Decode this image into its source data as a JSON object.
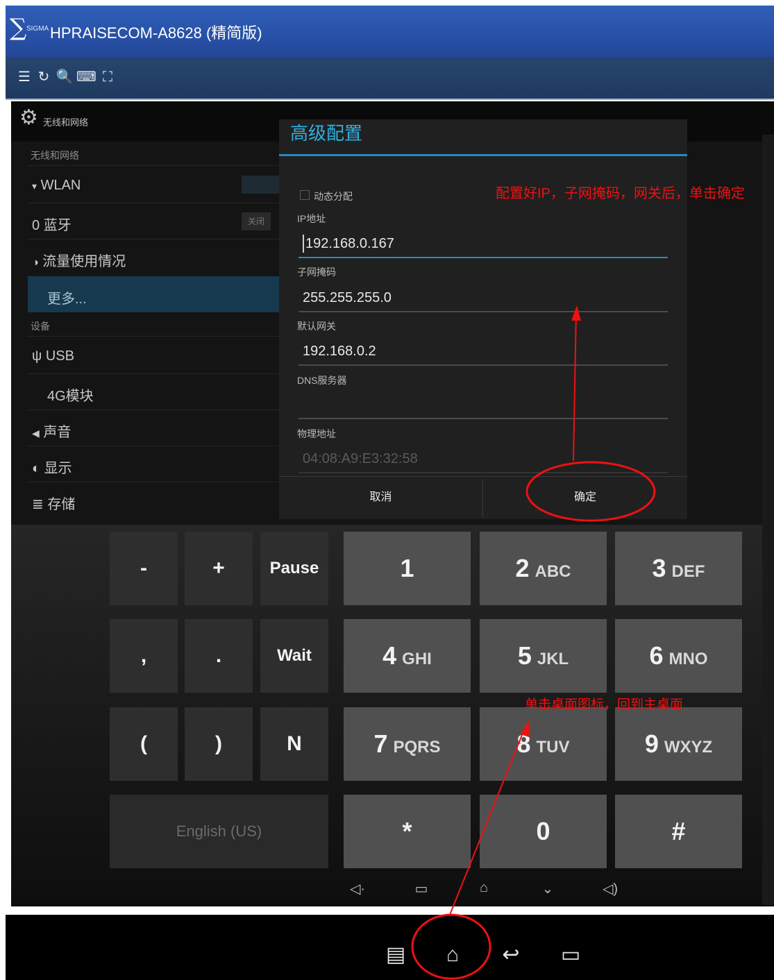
{
  "window": {
    "logo_glyph": "∑",
    "logo_small": "SIGMA",
    "title": "HPRAISECOM-A8628 (精简版)"
  },
  "toolbar": {
    "icons": [
      "menu-icon",
      "rotate-icon",
      "zoom-icon",
      "keyboard-icon",
      "fullscreen-icon"
    ],
    "glyphs": [
      "☰",
      "↻",
      "🔍",
      "⌨",
      "⛶"
    ]
  },
  "settings": {
    "header_title": "无线和网络",
    "category_wireless": "无线和网络",
    "items": [
      {
        "icon": "▾",
        "label": "WLAN"
      },
      {
        "icon": "0",
        "label": "蓝牙"
      },
      {
        "icon": "◑",
        "label": "流量使用情况"
      },
      {
        "icon": "",
        "label": "更多..."
      }
    ],
    "bluetooth_toggle": "关闭",
    "category_device": "设备",
    "device_items": [
      {
        "icon": "ψ",
        "label": "USB"
      },
      {
        "icon": "",
        "label": "4G模块"
      },
      {
        "icon": "◀",
        "label": "声音"
      },
      {
        "icon": "◐",
        "label": "显示"
      },
      {
        "icon": "≣",
        "label": "存储"
      }
    ]
  },
  "dialog": {
    "title": "高级配置",
    "dhcp_label": "动态分配",
    "ip_label": "IP地址",
    "ip_value": "192.168.0.167",
    "mask_label": "子网掩码",
    "mask_value": "255.255.255.0",
    "gateway_label": "默认网关",
    "gateway_value": "192.168.0.2",
    "dns_label": "DNS服务器",
    "dns_value": "",
    "mac_label": "物理地址",
    "mac_value": "04:08:A9:E3:32:58",
    "cancel_label": "取消",
    "ok_label": "确定"
  },
  "keypad": {
    "left_keys": [
      "-",
      "+",
      "Pause",
      ",",
      ".",
      "Wait",
      "(",
      ")",
      "N"
    ],
    "language_label": "English (US)",
    "digit_keys": [
      {
        "digit": "1",
        "letters": ""
      },
      {
        "digit": "2",
        "letters": "ABC"
      },
      {
        "digit": "3",
        "letters": "DEF"
      },
      {
        "digit": "4",
        "letters": "GHI"
      },
      {
        "digit": "5",
        "letters": "JKL"
      },
      {
        "digit": "6",
        "letters": "MNO"
      },
      {
        "digit": "7",
        "letters": "PQRS"
      },
      {
        "digit": "8",
        "letters": "TUV"
      },
      {
        "digit": "9",
        "letters": "WXYZ"
      },
      {
        "digit": "*",
        "letters": ""
      },
      {
        "digit": "0",
        "letters": ""
      },
      {
        "digit": "#",
        "letters": ""
      }
    ],
    "nav_glyphs": [
      "◁·",
      "▭",
      "⌂",
      "⌄",
      "◁)"
    ]
  },
  "system_bar": {
    "icons": [
      "menu-icon",
      "home-icon",
      "back-icon",
      "recent-apps-icon"
    ],
    "glyphs": [
      "▤",
      "⌂",
      "↩",
      "▭"
    ]
  },
  "annotations": {
    "top_note": "配置好IP，子网掩码，网关后，单击确定",
    "bottom_note": "单击桌面图标，回到主桌面",
    "color": "#ee1111"
  }
}
